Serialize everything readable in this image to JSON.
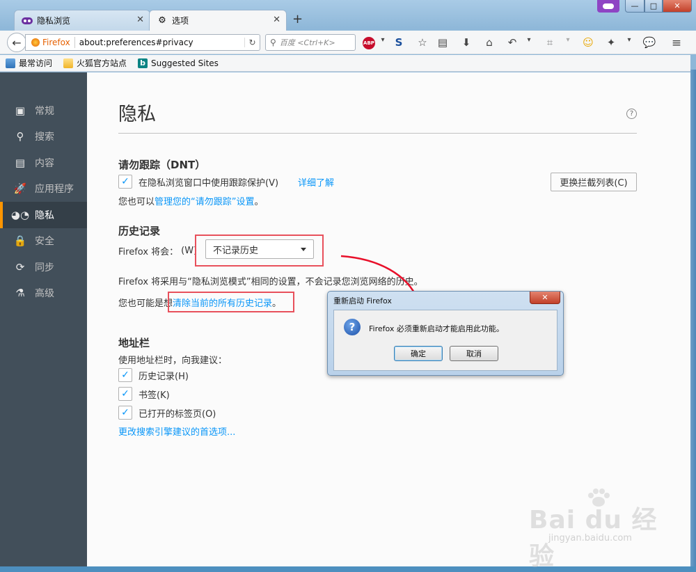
{
  "window": {
    "tabs": [
      {
        "label": "隐私浏览"
      },
      {
        "label": "选项"
      }
    ],
    "new_tab": "+",
    "controls": {
      "minimize": "—",
      "maximize": "□",
      "close": "✕"
    }
  },
  "navbar": {
    "identity": "Firefox",
    "url": "about:preferences#privacy",
    "search_placeholder": "百度 <Ctrl+K>",
    "abp": "ABP"
  },
  "bookmarks": [
    {
      "label": "最常访问"
    },
    {
      "label": "火狐官方站点"
    },
    {
      "label": "Suggested Sites"
    }
  ],
  "sidebar": {
    "items": [
      {
        "label": "常规",
        "icon": "general-icon"
      },
      {
        "label": "搜索",
        "icon": "search-icon"
      },
      {
        "label": "内容",
        "icon": "content-icon"
      },
      {
        "label": "应用程序",
        "icon": "applications-icon"
      },
      {
        "label": "隐私",
        "icon": "privacy-mask-icon"
      },
      {
        "label": "安全",
        "icon": "lock-icon"
      },
      {
        "label": "同步",
        "icon": "sync-icon"
      },
      {
        "label": "高级",
        "icon": "advanced-icon"
      }
    ],
    "active_index": 4
  },
  "main": {
    "title": "隐私",
    "help": "?",
    "dnt": {
      "heading": "请勿跟踪（DNT）",
      "checkbox_label": "在隐私浏览窗口中使用跟踪保护(V)",
      "learn_more": "详细了解",
      "block_list_button": "更换拦截列表(C)",
      "manage_prefix": "您也可以",
      "manage_link": "管理您的“请勿跟踪”设置",
      "manage_suffix": "。"
    },
    "history": {
      "heading": "历史记录",
      "will_label": "Firefox 将会：",
      "will_accesskey": "(W)",
      "select_value": "不记录历史",
      "description": "Firefox 将采用与“隐私浏览模式”相同的设置，不会记录您浏览网络的历史。",
      "clear_prefix": "您也可能是想",
      "clear_link": "清除当前的所有历史记录",
      "clear_suffix": "。"
    },
    "urlbar": {
      "heading": "地址栏",
      "intro": "使用地址栏时，向我建议：",
      "options": [
        {
          "label": "历史记录(H)",
          "checked": true
        },
        {
          "label": "书签(K)",
          "checked": true
        },
        {
          "label": "已打开的标签页(O)",
          "checked": true
        }
      ],
      "change_search_link": "更改搜索引擎建议的首选项..."
    }
  },
  "dialog": {
    "title": "重新启动 Firefox",
    "close": "✕",
    "message": "Firefox 必须重新启动才能启用此功能。",
    "ok": "确定",
    "cancel": "取消"
  },
  "watermark": {
    "brand": "Bai du 经验",
    "url": "jingyan.baidu.com"
  },
  "colors": {
    "accent": "#0996f8",
    "sidebar_bg": "#424f5a",
    "active_marker": "#ff9500",
    "annotation_red": "#e8505b"
  }
}
